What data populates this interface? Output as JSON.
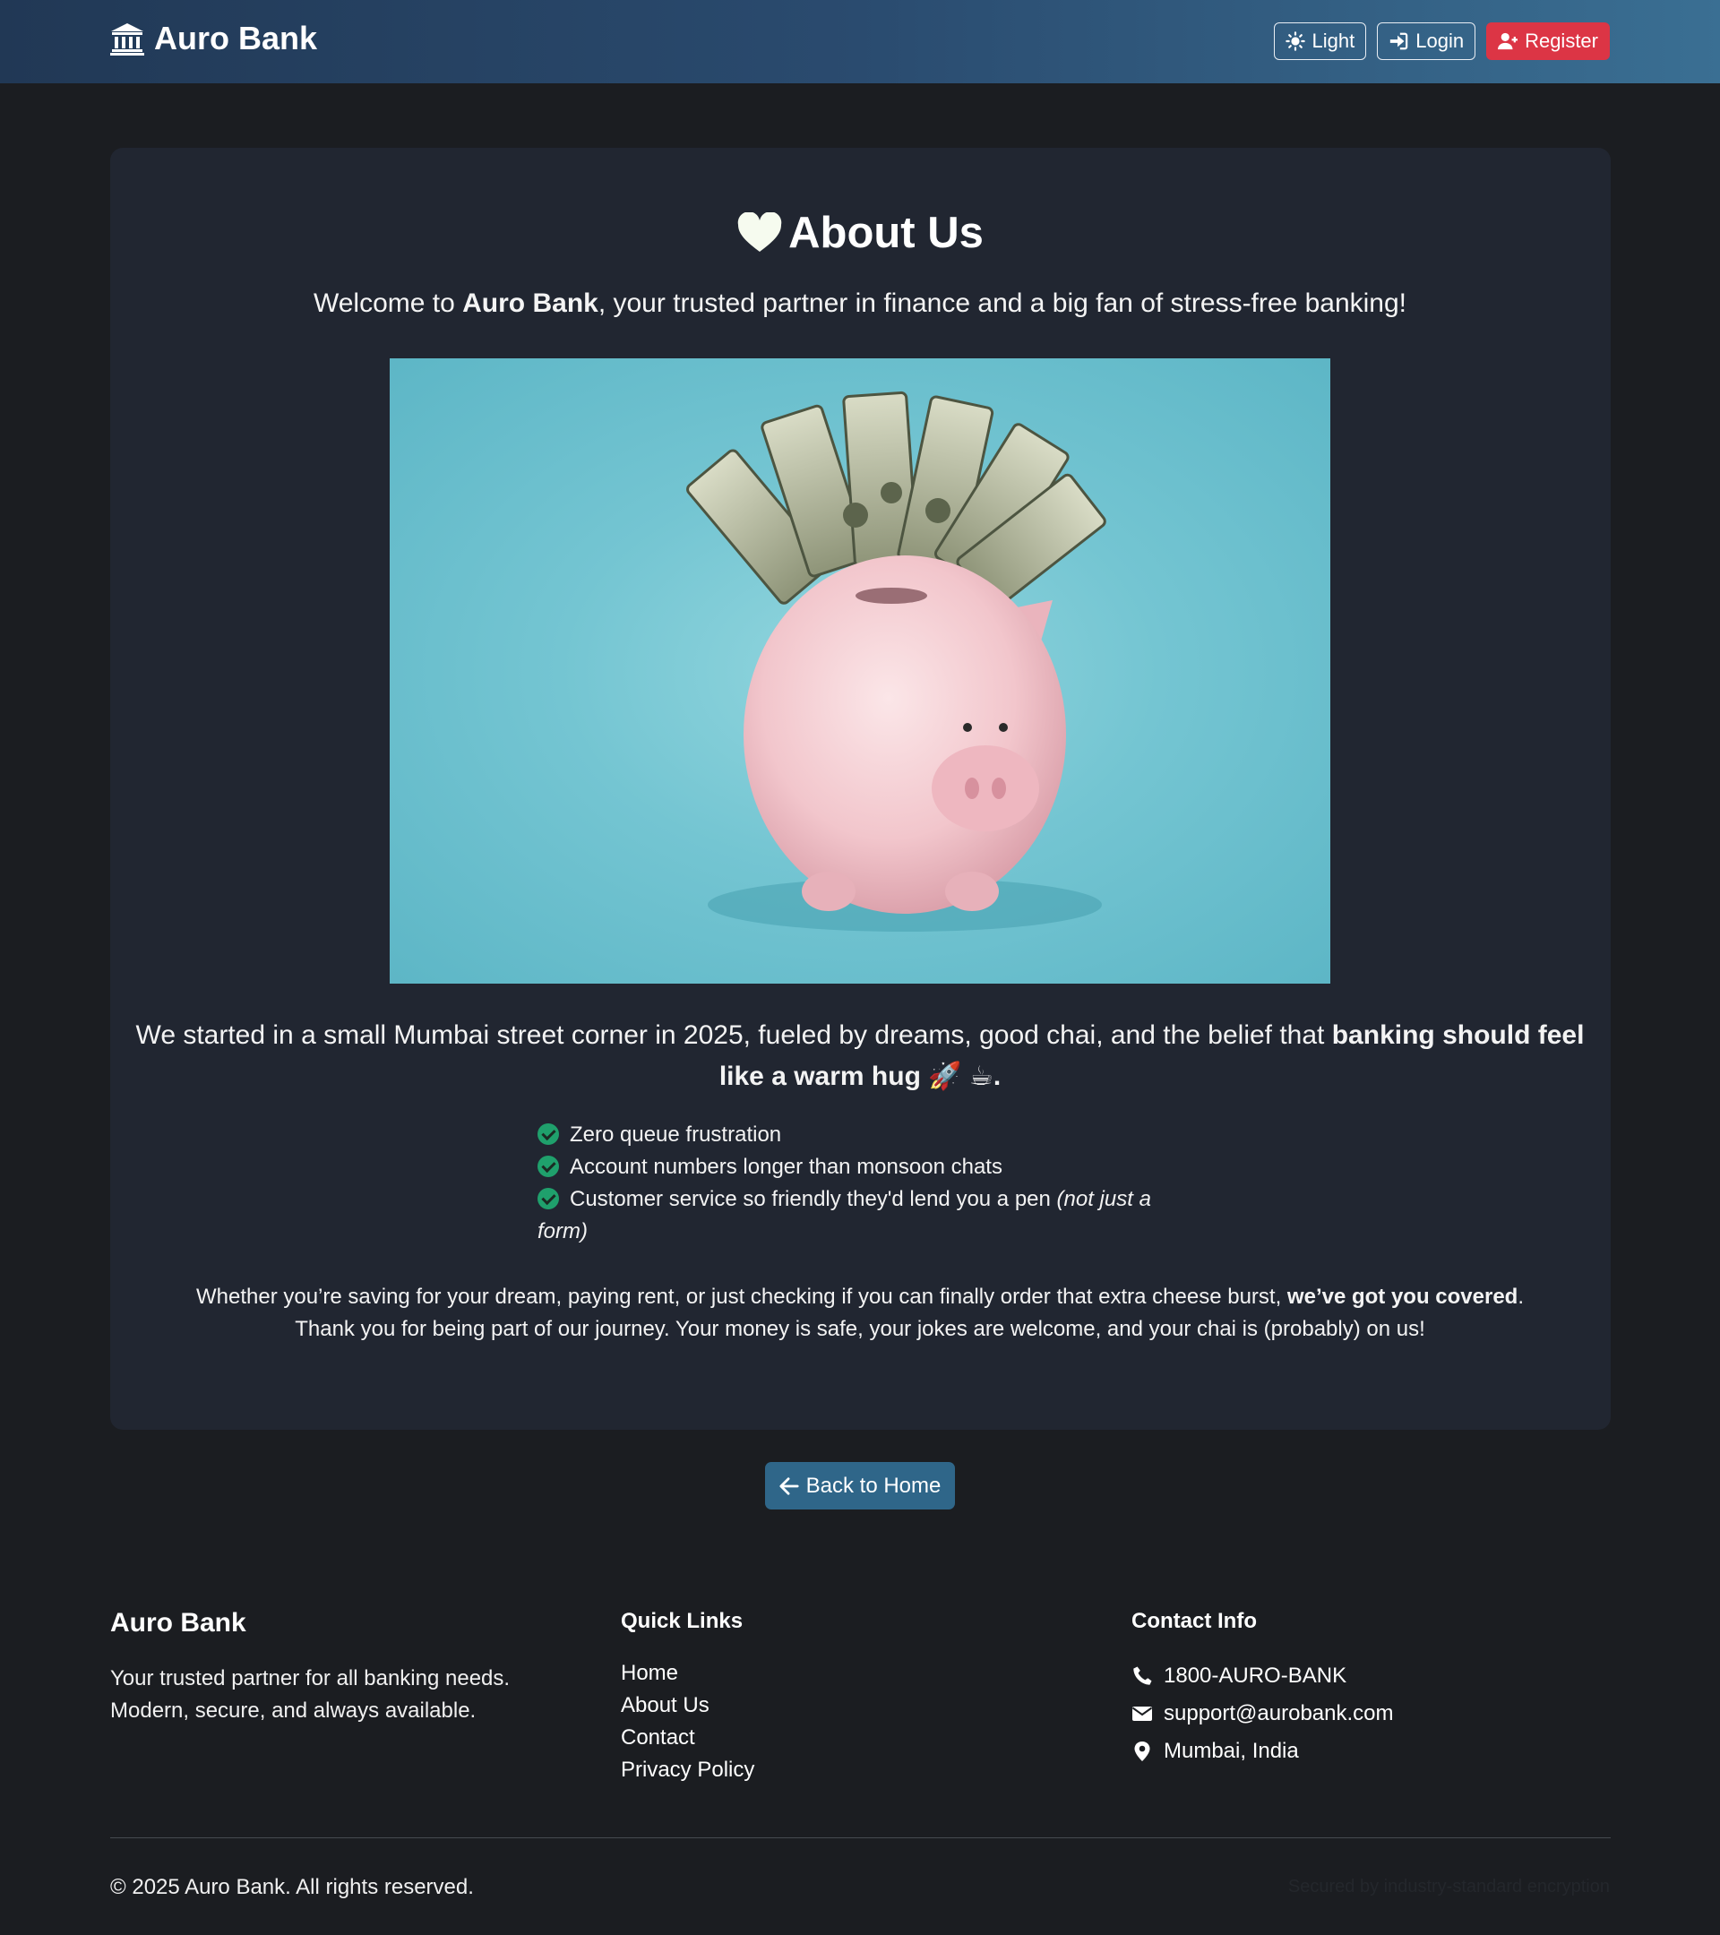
{
  "navbar": {
    "brand": "Auro Bank",
    "theme_label": "Light",
    "login_label": "Login",
    "register_label": "Register"
  },
  "about": {
    "title": "About Us",
    "lead_pre": "Welcome to ",
    "lead_brand": "Auro Bank",
    "lead_post": ", your trusted partner in finance and a big fan of stress-free banking!",
    "story_pre": "We started in a small Mumbai street corner in 2025, fueled by dreams, good chai, and the belief that ",
    "story_bold": "banking should feel like a warm hug 🚀 ☕.",
    "features": [
      "Zero queue frustration",
      "Account numbers longer than monsoon chats",
      "Customer service so friendly they'd lend you a pen"
    ],
    "feature_note": "(not just a form)",
    "closing_line1_pre": "Whether you’re saving for your dream, paying rent, or just checking if you can finally order that extra cheese burst, ",
    "closing_line1_bold": "we’ve got you covered",
    "closing_line1_post": ".",
    "closing_line2": "Thank you for being part of our journey. Your money is safe, your jokes are welcome, and your chai is (probably) on us!"
  },
  "back_button": "Back to Home",
  "footer": {
    "brand": "Auro Bank",
    "desc_line1": "Your trusted partner for all banking needs.",
    "desc_line2": "Modern, secure, and always available.",
    "quick_links_heading": "Quick Links",
    "quick_links": [
      "Home",
      "About Us",
      "Contact",
      "Privacy Policy"
    ],
    "contact_heading": "Contact Info",
    "phone": "1800-AURO-BANK",
    "email": "support@aurobank.com",
    "location": "Mumbai, India",
    "copyright": "© 2025 Auro Bank. All rights reserved.",
    "secured_text": "Secured by industry-standard encryption"
  },
  "colors": {
    "navbar_start": "#213855",
    "navbar_end": "#3a6f93",
    "page_bg": "#1b1d21",
    "card_bg": "#212631",
    "register_red": "#dc3545",
    "back_button_blue": "#2f6689",
    "check_green": "#1fa06c"
  },
  "icons": {
    "brand": "bank-icon",
    "theme": "sun-icon",
    "login": "sign-in-icon",
    "register": "user-plus-icon",
    "title": "heart-icon",
    "back": "arrow-left-icon",
    "phone": "phone-icon",
    "email": "envelope-icon",
    "location": "map-pin-icon"
  }
}
